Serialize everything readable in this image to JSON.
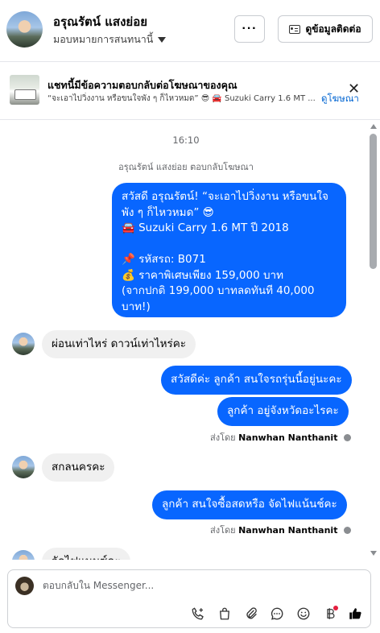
{
  "header": {
    "name": "อรุณรัตน์ แสงย่อย",
    "subtitle": "มอบหมายการสนทนานี้",
    "more_label": "···",
    "contact_label": "ดูข้อมูลติดต่อ"
  },
  "banner": {
    "title": "แชทนี้มีข้อความตอบกลับต่อโฆษณาของคุณ",
    "text": "“จะเอาไปวิ่งงาน หรือขนใจพัง ๆ ก็ไหวหมด” 😎 🚘 Suzuki Carry 1.6 MT ...",
    "link": "ดูโฆษณา",
    "close": "✕"
  },
  "chat": {
    "timestamp": "16:10",
    "notice": "อรุณรัตน์ แสงย่อย ตอบกลับโฆษณา",
    "ad_reply": [
      "สวัสดี อรุณรัตน์! “จะเอาไปวิ่งงาน หรือขนใจพัง ๆ ก็ไหวหมด” 😎",
      "🚘 Suzuki Carry 1.6 MT ปี 2018",
      "",
      "📌 รหัสรถ: B071",
      "💰 ราคาพิเศษเพียง 159,000 บาท",
      "(จากปกติ 199,000 บาทลดทันที 40,000 บาท!)"
    ],
    "msg_in_1": "ผ่อนเท่าไหร่ ดาวน์เท่าไหร่คะ",
    "msg_out_1": "สวัสดีค่ะ ลูกค้า สนใจรถรุ่นนี้อยู่นะคะ",
    "msg_out_2": "ลูกค้า อยู่จังหวัดอะไรคะ",
    "sent_by_prefix": "ส่งโดย",
    "sent_by_name": "Nanwhan Nanthanit",
    "msg_in_2": "สกลนครคะ",
    "msg_out_3": "ลูกค้า สนใจซื้อสดหรือ จัดไฟแน้นช์คะ",
    "msg_in_3": "จัดไฟแนนซ์คะ"
  },
  "composer": {
    "placeholder": "ตอบกลับใน Messenger..."
  },
  "colors": {
    "accent": "#0866ff",
    "link": "#0064d1",
    "incoming": "#f0f0f0",
    "badge": "#e41e3f"
  }
}
